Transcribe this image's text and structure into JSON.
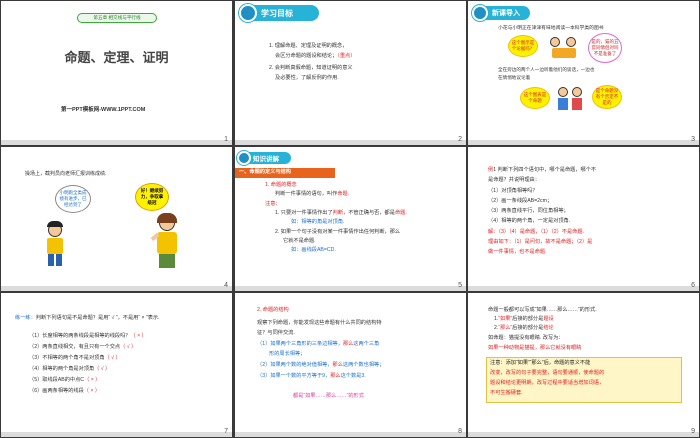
{
  "slides": [
    {
      "num": "1",
      "badge": "第五章 相交线与平行线",
      "title": "命题、定理、证明",
      "site": "第一PPT模板网-WWW.1PPT.COM"
    },
    {
      "num": "2",
      "header": "学习目标",
      "lines": [
        [
          "1. 理解命题、定理及证明的概念，",
          ""
        ],
        [
          "会区分命题的题设和结论；",
          "（重点）"
        ],
        [
          "2. 会判断真假命题，知道证明的意义",
          ""
        ],
        [
          "及必要性，了解反例的作用.",
          ""
        ]
      ]
    },
    {
      "num": "3",
      "header": "新课导入",
      "intro": "小花与小明正在津津有味地阅读一本科学类的图书",
      "cloud1": "这个图示是个论据吗？",
      "cloud2": "是的，猫的五官同情侣对吗不是准备了",
      "mid": "全在旁边的两个人一边听着他们的谈话，一边也",
      "mid2": "在情悄地议论着",
      "cloud3": "这个图表是个命题",
      "cloud4": "是个命题没有个否定不是的"
    },
    {
      "num": "4",
      "text": "操场上，截判员向老师汇报训练成绩.",
      "cloud1": "小明跑全类成绩有进步，已经达到了",
      "cloud2": "好！继续努力，争取拿级冠"
    },
    {
      "num": "5",
      "header": "知识讲解",
      "section": "一、命题的定义与结构",
      "l1": "1. 命题的概念",
      "l2": "判断一件事情的语句，叫作",
      "l2b": "命题.",
      "l3": "注意：",
      "l4": "1. 只要对一件事情作出了",
      "l4b": "判断",
      "l4c": "，不管正确与否，都是",
      "l4d": "命题.",
      "l5": "如：相等的角是对顶角.",
      "l6": "2. 如果一个句子没有对某一件事情作出任何判断，那么",
      "l7": "它就不是命题.",
      "l8": "如：画线段AB=CD."
    },
    {
      "num": "6",
      "l1a": "例",
      "l1b": "1 判断下列四个语句中，哪个是命题，哪个不",
      "l2": "是命题？并说明理由：",
      "q1": "（1）对顶角相等吗？",
      "q2": "（2）画一条线段AB=2cm；",
      "q3": "（3）两条直线平行，同位角相等；",
      "q4": "（4）相等的两个角，一定是对顶角.",
      "a1": "解：（3）（4）是命题，（1）（2）不是命题.",
      "a2": "理由如下：（1）是问句，故不是命题；（2）是",
      "a3": "做一件事情，也不是命题."
    },
    {
      "num": "7",
      "lead": "练一练：",
      "leadb": "判断下列语句是不是命题？是用“ √ ”，不是用“ × ”表示.",
      "items": [
        [
          "（1）长度相等的两条线段是相等的线段吗？",
          "（ × ）"
        ],
        [
          "（2）两条直线相交，有且只有一个交点",
          "（ √ ）"
        ],
        [
          "（3）不相等的两个角不是对顶角",
          "（ √ ）"
        ],
        [
          "（4）相等的两个角是对顶角",
          "（ √ ）"
        ],
        [
          "（5）取线段AB的中点C",
          "（ × ）"
        ],
        [
          "（6）画两条相等的线段",
          "（ × ）"
        ]
      ]
    },
    {
      "num": "8",
      "h": "2. 命题的结构",
      "p1": "观察下列命题，你能发现这些命题有什么共同的结构特",
      "p2": "征？与同伴交流.",
      "i1a": "（1）如果两个三角形的三条边相等，",
      "i1b": "那么",
      "i1c": "这两个三角",
      "i1d": "形的周长相等；",
      "i2a": "（2）如果两个数的绝对值相等，",
      "i2b": "那么",
      "i2c": "这两个数也相等；",
      "i3a": "（3）如果一个数的平方等于9，",
      "i3b": "那么",
      "i3c": "这个数是3.",
      "foot": "都是“如果……那么……”的形式"
    },
    {
      "num": "9",
      "t1": "命题一般都可以写成“如果……那么……”的形式.",
      "t2a": "1.",
      "t2b": "“如果”",
      "t2c": "后接的部分是",
      "t2d": "题设",
      "t3a": "2.",
      "t3b": "“那么”",
      "t3c": "后接的部分是",
      "t3d": "结论",
      "t4": "如命题：猫提没有眼睛. 改写为：",
      "t5": "如果一种动物是猫提，那么它就没有眼睛",
      "n1": "注意：添加“如果”“那么”后，命题的意义不能",
      "n2": "改变，改写的句子要完整，语句要通顺，使命题的",
      "n3": "题设和结论更明朗，改写过程中要适当增加词语，",
      "n4": "不可生搬硬套."
    }
  ],
  "colors": {
    "title_green": "#2e8b2e",
    "header_cyan": "#27b3d8",
    "red": "#e02020",
    "blue": "#1a6fd0",
    "orange": "#e8641e"
  }
}
